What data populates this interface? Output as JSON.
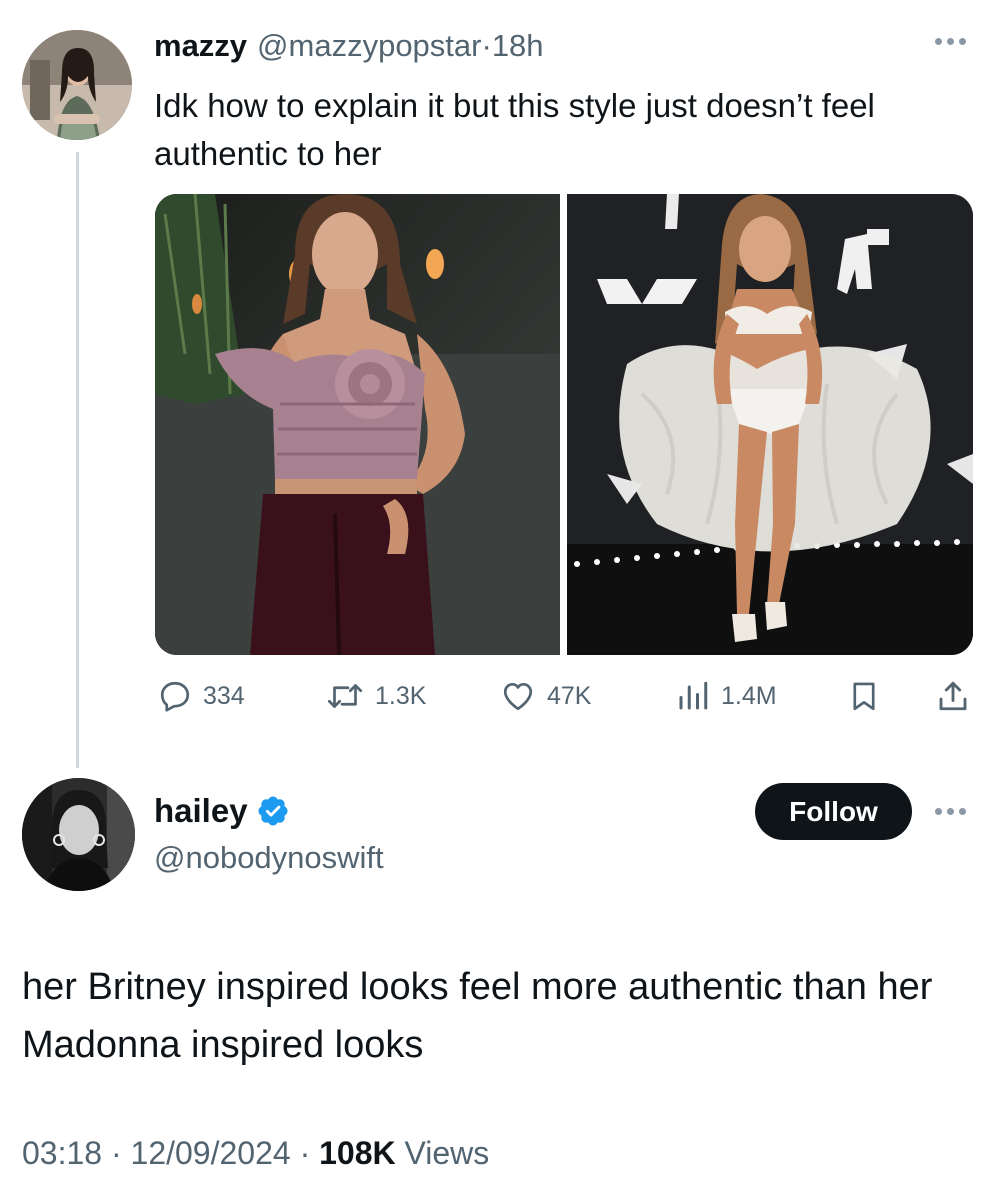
{
  "parent_tweet": {
    "display_name": "mazzy",
    "handle": "@mazzypopstar",
    "separator": "·",
    "time": "18h",
    "text": "Idk how to explain it but this style just doesn’t feel authentic to her",
    "media": [
      "photo-velvet-corset-outfit",
      "photo-vmas-white-tulle-outfit"
    ],
    "actions": {
      "replies": "334",
      "reposts": "1.3K",
      "likes": "47K",
      "views": "1.4M"
    }
  },
  "reply_tweet": {
    "display_name": "hailey",
    "verified": true,
    "handle": "@nobodynoswift",
    "follow_label": "Follow",
    "text": "her Britney inspired looks feel more authentic than her Madonna inspired looks",
    "timestamp": "03:18 · 12/09/2024 · ",
    "views_count": "108K",
    "views_label": " Views"
  },
  "colors": {
    "text_primary": "#0f1419",
    "text_secondary": "#536471",
    "verified_blue": "#1d9bf0",
    "follow_button": "#0f1419",
    "thread_line": "#cfd9de"
  },
  "icons": [
    "reply-icon",
    "repost-icon",
    "like-icon",
    "views-icon",
    "bookmark-icon",
    "share-icon",
    "verified-badge-icon",
    "more-options-icon"
  ]
}
